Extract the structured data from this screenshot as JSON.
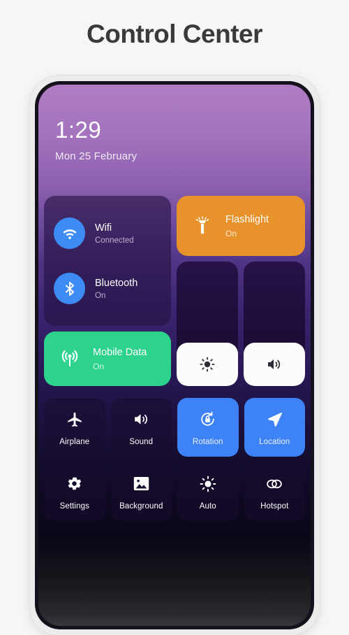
{
  "header": {
    "title": "Control Center"
  },
  "colors": {
    "page_bg": "#f6f6f6",
    "title": "#3a3a3c",
    "accent_blue": "#3d82f6",
    "icon_blue": "#3d8bf5",
    "mobile_green": "#2dd28c",
    "flashlight_orange": "#e8922b",
    "slider_fill": "#fcfcfc",
    "screen_top": "#b07dc4",
    "screen_bottom": "#38383c"
  },
  "status": {
    "time": "1:29",
    "date": "Mon 25 February"
  },
  "connectivity": [
    {
      "icon": "wifi-icon",
      "title": "Wifi",
      "subtitle": "Connected"
    },
    {
      "icon": "bluetooth-icon",
      "title": "Bluetooth",
      "subtitle": "On"
    }
  ],
  "mobile_data": {
    "icon": "cell-signal-icon",
    "title": "Mobile Data",
    "subtitle": "On"
  },
  "flashlight": {
    "icon": "flashlight-icon",
    "title": "Flashlight",
    "subtitle": "On"
  },
  "sliders": [
    {
      "name": "brightness-slider",
      "icon": "brightness-icon",
      "value": 35
    },
    {
      "name": "volume-slider",
      "icon": "volume-icon",
      "value": 35
    }
  ],
  "grid_tiles": [
    {
      "icon": "airplane-icon",
      "label": "Airplane",
      "active": false
    },
    {
      "icon": "volume-icon",
      "label": "Sound",
      "active": false
    },
    {
      "icon": "rotation-lock-icon",
      "label": "Rotation",
      "active": true
    },
    {
      "icon": "location-arrow-icon",
      "label": "Location",
      "active": true
    },
    {
      "icon": "gear-icon",
      "label": "Settings",
      "active": false
    },
    {
      "icon": "image-icon",
      "label": "Background",
      "active": false
    },
    {
      "icon": "brightness-icon",
      "label": "Auto",
      "active": false
    },
    {
      "icon": "hotspot-icon",
      "label": "Hotspot",
      "active": false
    }
  ]
}
